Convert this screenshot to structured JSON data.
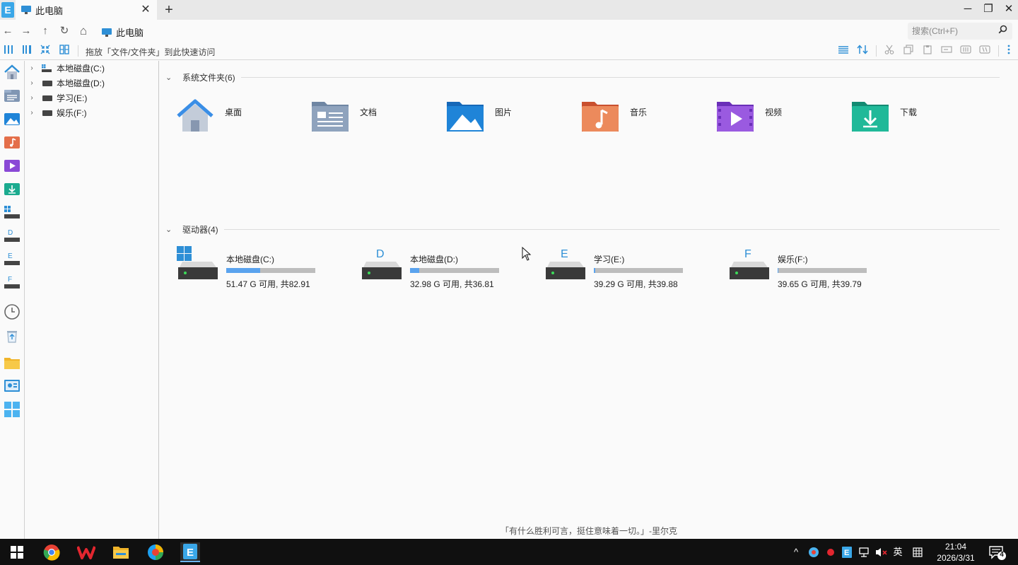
{
  "tabbar": {
    "app_logo_letter": "E",
    "tab_title": "此电脑",
    "close_glyph": "✕",
    "add_glyph": "+",
    "minimize_glyph": "─",
    "maximize_glyph": "❐",
    "window_close_glyph": "✕"
  },
  "address": {
    "back_glyph": "←",
    "forward_glyph": "→",
    "up_glyph": "↑",
    "refresh_glyph": "↻",
    "home_glyph": "⌂",
    "breadcrumb_label": "此电脑",
    "search_placeholder": "搜索(Ctrl+F)",
    "search_value": ""
  },
  "toolbar": {
    "pin_hint": "拖放「文件/文件夹」到此快速访问"
  },
  "tree": [
    {
      "label": "本地磁盘(C:)",
      "icon": "windows-drive-icon"
    },
    {
      "label": "本地磁盘(D:)",
      "icon": "drive-icon"
    },
    {
      "label": "学习(E:)",
      "icon": "drive-icon"
    },
    {
      "label": "娱乐(F:)",
      "icon": "drive-icon"
    }
  ],
  "sections": {
    "system_folders_title": "系统文件夹(6)",
    "drives_title": "驱动器(4)"
  },
  "folders": [
    {
      "label": "桌面",
      "icon": "home-folder-icon",
      "color": "#3a8ee6"
    },
    {
      "label": "文档",
      "icon": "documents-folder-icon",
      "color": "#7f93ad"
    },
    {
      "label": "图片",
      "icon": "pictures-folder-icon",
      "color": "#1f84d8"
    },
    {
      "label": "音乐",
      "icon": "music-folder-icon",
      "color": "#e46f4a"
    },
    {
      "label": "视频",
      "icon": "videos-folder-icon",
      "color": "#8a49d6"
    },
    {
      "label": "下载",
      "icon": "downloads-folder-icon",
      "color": "#1bab8f"
    }
  ],
  "drives": [
    {
      "letter": "",
      "name": "本地磁盘(C:)",
      "free_text": "51.47 G 可用, 共82.91",
      "used_fraction": 0.379
    },
    {
      "letter": "D",
      "name": "本地磁盘(D:)",
      "free_text": "32.98 G 可用, 共36.81",
      "used_fraction": 0.104
    },
    {
      "letter": "E",
      "name": "学习(E:)",
      "free_text": "39.29 G 可用, 共39.88",
      "used_fraction": 0.015
    },
    {
      "letter": "F",
      "name": "娱乐(F:)",
      "free_text": "39.65 G 可用, 共39.79",
      "used_fraction": 0.004
    }
  ],
  "quote": "「有什么胜利可言，挺住意味着一切。」-里尔克",
  "taskbar": {
    "tray_chevron": "^",
    "ime_label": "英",
    "time": "21:04",
    "date": "2026/3/31",
    "notification_count": "4"
  },
  "colors": {
    "accent": "#2e8fd6",
    "drive_bar_fill": "#5aa3ee",
    "drive_bar_track": "#bdbdbd"
  }
}
